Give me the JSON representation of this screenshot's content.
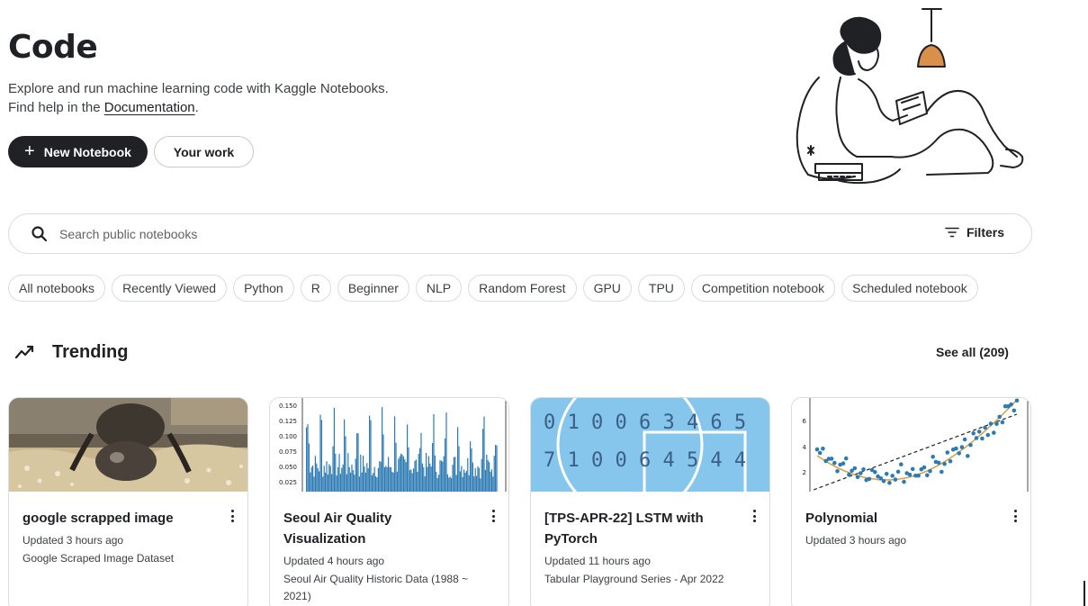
{
  "header": {
    "title": "Code",
    "subtitle_line1": "Explore and run machine learning code with Kaggle Notebooks.",
    "subtitle_line2_prefix": "Find help in the ",
    "documentation_link": "Documentation",
    "subtitle_line2_suffix": ".",
    "new_notebook_label": "New Notebook",
    "your_work_label": "Your work"
  },
  "search": {
    "placeholder": "Search public notebooks",
    "value": "",
    "filters_label": "Filters"
  },
  "chips": [
    "All notebooks",
    "Recently Viewed",
    "Python",
    "R",
    "Beginner",
    "NLP",
    "Random Forest",
    "GPU",
    "TPU",
    "Competition notebook",
    "Scheduled notebook"
  ],
  "trending": {
    "title": "Trending",
    "see_all_label": "See all (209)",
    "cards": [
      {
        "title": "google scrapped image",
        "updated": "Updated 3 hours ago",
        "source": "Google Scraped Image Dataset"
      },
      {
        "title": "Seoul Air Quality Visualization",
        "updated": "Updated 4 hours ago",
        "source": "Seoul Air Quality Historic Data (1988 ~ 2021)",
        "thumb_ticks": [
          "0.150",
          "0.125",
          "0.100",
          "0.075",
          "0.050",
          "0.025"
        ]
      },
      {
        "title": "[TPS-APR-22] LSTM with PyTorch",
        "updated": "Updated 11 hours ago",
        "source": "Tabular Playground Series - Apr 2022",
        "thumb_digits_row1": "0 1 0 0 6 3 4 6 5",
        "thumb_digits_row2": "7 1 0 0 6 4 5 4 4"
      },
      {
        "title": "Polynomial",
        "updated": "Updated 3 hours ago",
        "source": "",
        "thumb_ticks": [
          "6",
          "4",
          "2"
        ]
      }
    ]
  },
  "colors": {
    "primary_dark": "#202124",
    "border": "#dadce0",
    "text_secondary": "#3c4043",
    "thumb_blue": "#2e7bb4",
    "thumb_sky": "#86c6ec"
  }
}
